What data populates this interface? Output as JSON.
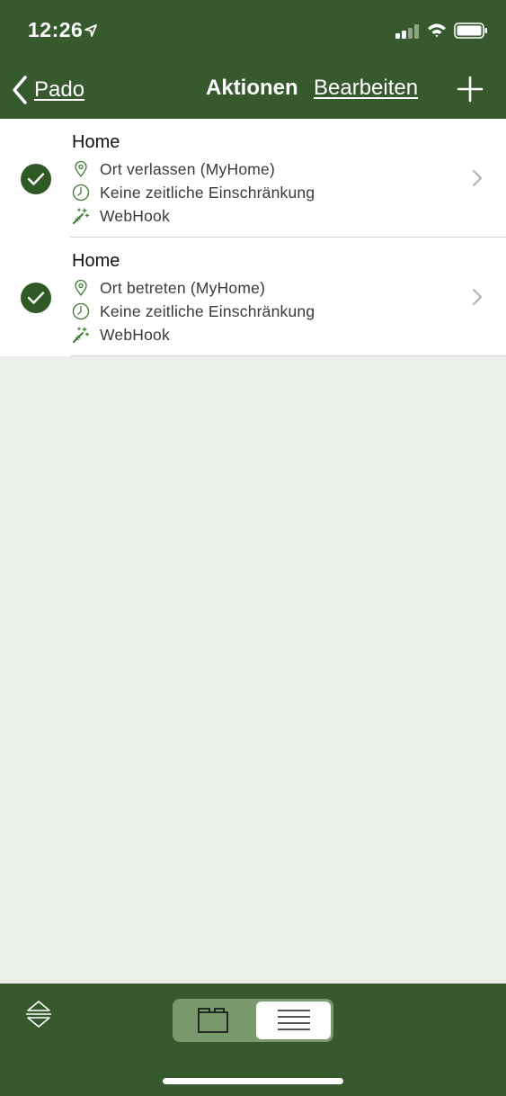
{
  "status_bar": {
    "time": "12:26"
  },
  "nav": {
    "back_label": "Pado",
    "title": "Aktionen",
    "edit_label": "Bearbeiten"
  },
  "actions": [
    {
      "title": "Home",
      "location": "Ort verlassen (MyHome)",
      "time": "Keine zeitliche Einschränkung",
      "action": "WebHook"
    },
    {
      "title": "Home",
      "location": "Ort betreten (MyHome)",
      "time": "Keine zeitliche Einschränkung",
      "action": "WebHook"
    }
  ],
  "colors": {
    "bar": "#37592e",
    "accent": "#2f5a25",
    "background": "#ebefea"
  },
  "icons": {
    "location": "map-pin-icon",
    "time": "clock-icon",
    "action": "magic-wand-icon",
    "enabled": "checkmark-icon"
  }
}
